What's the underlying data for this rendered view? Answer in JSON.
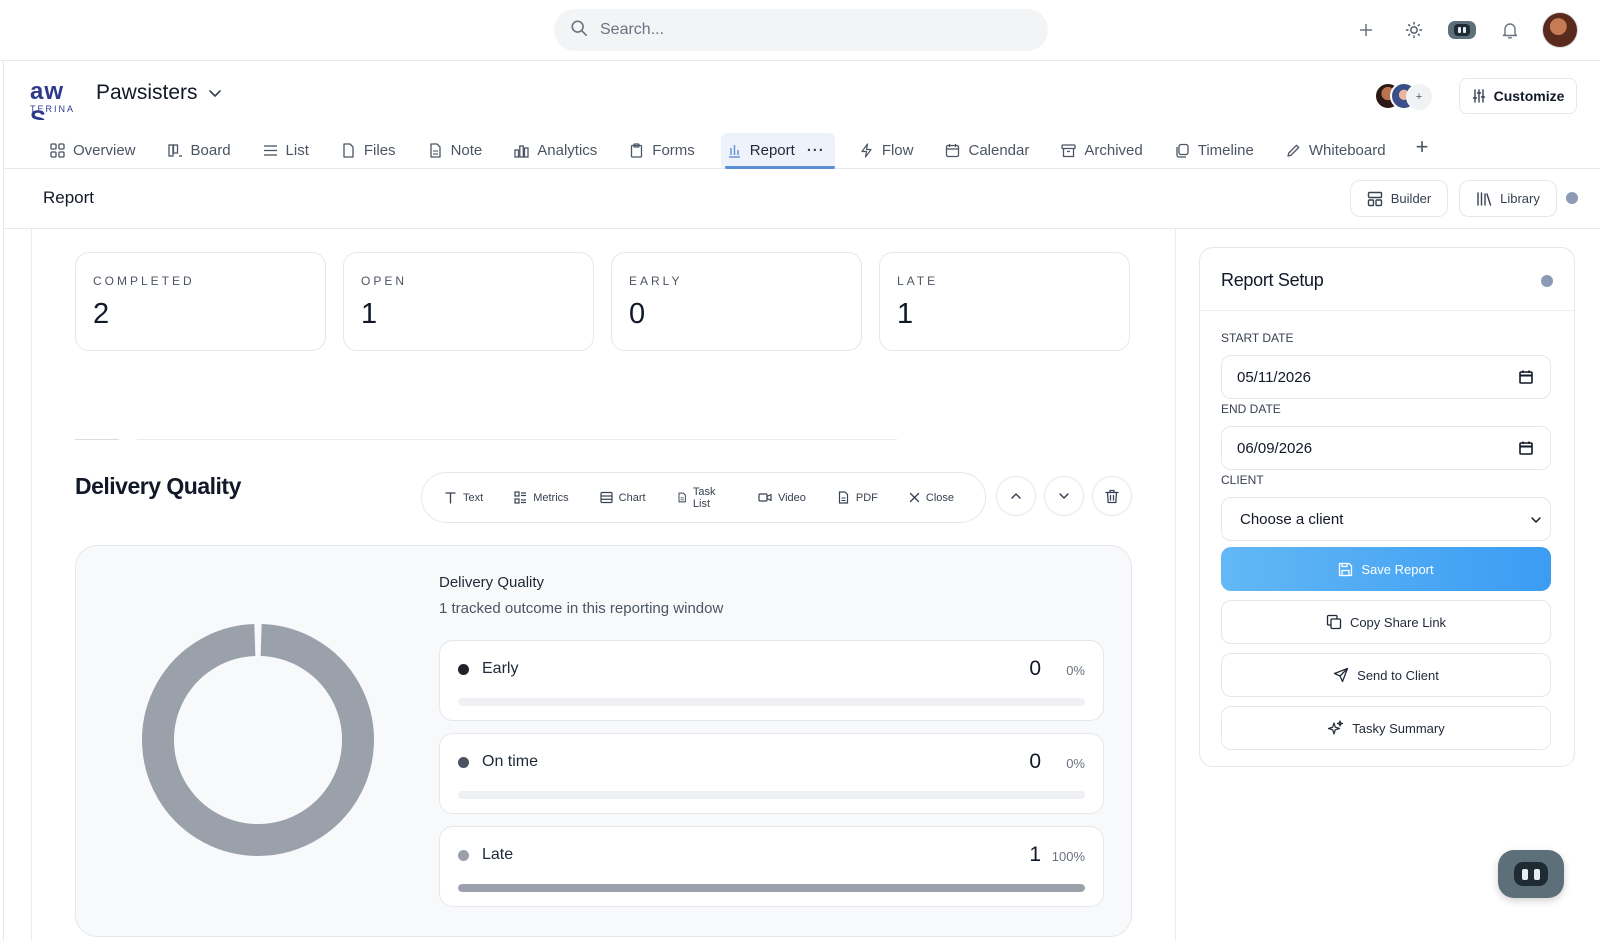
{
  "topbar": {
    "search_placeholder": "Search...",
    "icons": [
      "plus-icon",
      "sun-icon",
      "robot-icon",
      "bell-icon",
      "user-avatar"
    ]
  },
  "workspace": {
    "logo_text_top": "aw S",
    "logo_text_bottom": "TERINA",
    "name": "Pawsisters",
    "customize_label": "Customize",
    "member_more": "+"
  },
  "tabs": [
    {
      "label": "Overview",
      "icon": "grid-icon"
    },
    {
      "label": "Board",
      "icon": "board-icon"
    },
    {
      "label": "List",
      "icon": "list-icon"
    },
    {
      "label": "Files",
      "icon": "file-icon"
    },
    {
      "label": "Note",
      "icon": "note-icon"
    },
    {
      "label": "Analytics",
      "icon": "bar-chart-icon"
    },
    {
      "label": "Forms",
      "icon": "clipboard-icon"
    },
    {
      "label": "Report",
      "icon": "report-icon",
      "active": true,
      "more": "···"
    },
    {
      "label": "Flow",
      "icon": "lightning-icon"
    },
    {
      "label": "Calendar",
      "icon": "calendar-icon"
    },
    {
      "label": "Archived",
      "icon": "archive-icon"
    },
    {
      "label": "Timeline",
      "icon": "timeline-icon"
    },
    {
      "label": "Whiteboard",
      "icon": "pencil-icon"
    }
  ],
  "tab_add": "+",
  "subheader": {
    "title": "Report",
    "builder_label": "Builder",
    "library_label": "Library"
  },
  "stats": [
    {
      "label": "COMPLETED",
      "value": "2"
    },
    {
      "label": "OPEN",
      "value": "1"
    },
    {
      "label": "EARLY",
      "value": "0"
    },
    {
      "label": "LATE",
      "value": "1"
    }
  ],
  "section": {
    "title": "Delivery Quality",
    "toolbar": [
      {
        "label": "Text",
        "icon": "text-icon"
      },
      {
        "label": "Metrics",
        "icon": "metrics-icon"
      },
      {
        "label": "Chart",
        "icon": "chart-icon"
      },
      {
        "label": "Task List",
        "icon": "task-list-icon"
      },
      {
        "label": "Video",
        "icon": "video-icon"
      },
      {
        "label": "PDF",
        "icon": "pdf-icon"
      },
      {
        "label": "Close",
        "icon": "close-icon"
      }
    ]
  },
  "quality_card": {
    "title": "Delivery Quality",
    "subtitle": "1 tracked outcome in this reporting window",
    "rows": [
      {
        "name": "Early",
        "count": "0",
        "percent": "0%",
        "fraction": 0,
        "dot_color": "#1f2328"
      },
      {
        "name": "On time",
        "count": "0",
        "percent": "0%",
        "fraction": 0,
        "dot_color": "#4b5260"
      },
      {
        "name": "Late",
        "count": "1",
        "percent": "100%",
        "fraction": 1,
        "dot_color": "#9ba1ab"
      }
    ],
    "donut_color": "#9ba1ab"
  },
  "setup": {
    "title": "Report Setup",
    "start_label": "START DATE",
    "start_value": "05/11/2026",
    "end_label": "END DATE",
    "end_value": "06/09/2026",
    "client_label": "CLIENT",
    "client_value": "Choose a client",
    "save_label": "Save Report",
    "copy_label": "Copy Share Link",
    "send_label": "Send to Client",
    "summary_label": "Tasky Summary"
  },
  "colors": {
    "accent": "#5b8fd8",
    "save_gradient_start": "#63b8f5",
    "save_gradient_end": "#3b9cf3"
  }
}
